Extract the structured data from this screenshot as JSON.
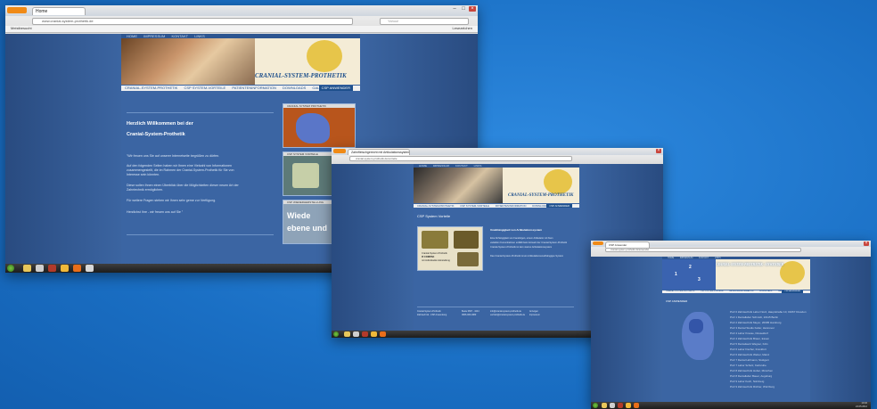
{
  "window1": {
    "tab_title": "Home",
    "url": "www.cranial-system-prothetik.de",
    "search_placeholder": "Yahoo!",
    "bookmarks_label": "Meistbesucht",
    "bookmarks_right": "Lesezeichen",
    "top_nav": [
      "HOME",
      "IMPRESSUM",
      "KONTAKT",
      "LINKS"
    ],
    "logo_text": "CRANIAL-SYSTEM-PROTHETIK",
    "menu": [
      "CRANIAL-SYSTEM-PROTHETIK",
      "CSP SYSTEM-VORTEILE",
      "PATIENTENINFORMATION",
      "DOWNLOADS",
      "GALERIE"
    ],
    "menu_right": "CSP ANWENDER",
    "heading_line1": "Herzlich Willkommen bei der",
    "heading_line2": "Cranial-System-Prothetik",
    "paragraphs": [
      "\"Wir freuen uns Sie auf unserer Internetseite begrüßen zu dürfen.",
      "Auf den folgenden Seiten haben wir Ihnen eine Vielzahl von Informationen",
      "zusammengestellt, die im Rahmen der Cranial-System-Prothetik für Sie von",
      "Interesse sein könnten.",
      "Diese sollen Ihnen einen Überblick über die Möglichkeiten dieser neuen Art der",
      "Zahntechnik ermöglichen.",
      "Für weitere Fragen stehen wir Ihnen sehr gerne zur Verfügung.",
      "Herzlichst Ihre - wir freuen uns auf Sie \""
    ],
    "thumb_titles": [
      "CRANIAL SYSTEM PROTHETIK",
      "CSP SYSTEM VORTEILE",
      "CSP WIEDERHERSTELLUNG"
    ],
    "thumb3_text1": "Wiede",
    "thumb3_text2": "ebene und"
  },
  "window2": {
    "tab_title": "Zahnfleischgerecht mit Artikulationssystem",
    "url": "cranial-system-prothetik.de/vorteile",
    "top_nav": [
      "HOME",
      "IMPRESSUM",
      "KONTAKT",
      "LINKS"
    ],
    "logo_text": "CRANIAL-SYSTEM-PROTHETIK",
    "menu": [
      "CRANIAL-SYSTEM-PROTHETIK",
      "CSP SYSTEM-VORTEILE",
      "PATIENTENINFORMATION",
      "DOWNLOADS",
      "GALERIE"
    ],
    "menu_right": "CSP ANWENDER",
    "section_title": "CSP System Vorteile",
    "article_title": "Unabhängigkeit von Artikulationssystem",
    "article_lines": [
      "Eine Abhängigkeit von Facebögen, einem Artikulator mit fixen",
      "variablen Kurvenbahnen entfällt beim Einsatz der Cranial-System-Prothetik",
      "Cranial-System-Prothetik ist kein starres Artikulationssystem",
      "Das Cranial-System-Prothetik ist ein Artikulationsunabhängiges System"
    ],
    "image_caption": [
      "Cranial-System-Prothetik",
      "IF COMPAK",
      "mit individuellen Einstellung"
    ],
    "footer_cols": [
      [
        "Cranial-System-Prothetik",
        "Zahntechnik - CSP Anwendung"
      ],
      [
        "Beste 0667 - 4444",
        "0666-006-1880"
      ],
      [
        "info@cranial-system-prothetik.de",
        "vertrieb@cranial-system-prothetik.de"
      ],
      [
        "Anzeigen",
        "Impressum"
      ]
    ]
  },
  "window3": {
    "tab_title": "CSP Anwender",
    "url": "cranial-system-prothetik.de/anwender",
    "top_nav": [
      "HOME",
      "IMPRESSUM",
      "KONTAKT",
      "LINKS"
    ],
    "logo_text": "CRANIAL-SYSTEM-PROTHETIK · ANWENDER",
    "menu": [
      "CRANIAL-SYSTEM-PROTHETIK",
      "CSP SYSTEM-VORTEILE",
      "PATIENTENINFORMATION",
      "DOWNLOADS",
      "GALERIE"
    ],
    "menu_right": "CSP ANWENDER",
    "section_title": "CSP ANWENDER",
    "map_numbers": [
      "1",
      "2",
      "3"
    ],
    "list": [
      "PLZ 0 Zahntechnik Labor Nord, Hauptstraße 10, 01067 Dresden",
      "PLZ 1 Dentallabor Schmidt, 10115 Berlin",
      "PLZ 2 Zahntechnik Meyer, 20095 Hamburg",
      "PLZ 3 Dental Studio Keller, Hannover",
      "PLZ 4 Labor Krause, Düsseldorf",
      "PLZ 4 Zahntechnik Braun, Essen",
      "PLZ 5 Dentalwerk Wagner, Köln",
      "PLZ 6 Labor Fischer, Frankfurt",
      "PLZ 6 Zahntechnik Weber, Mainz",
      "PLZ 7 Dental Hofmann, Stuttgart",
      "PLZ 7 Labor Schulz, Karlsruhe",
      "PLZ 8 Zahntechnik Huber, München",
      "PLZ 8 Dentallabor Bauer, Augsburg",
      "PLZ 9 Labor Koch, Nürnberg",
      "PLZ 9 Zahntechnik Richter, Würzburg"
    ]
  },
  "taskbar": {
    "time": "10:32",
    "date": "24.05.2012"
  }
}
